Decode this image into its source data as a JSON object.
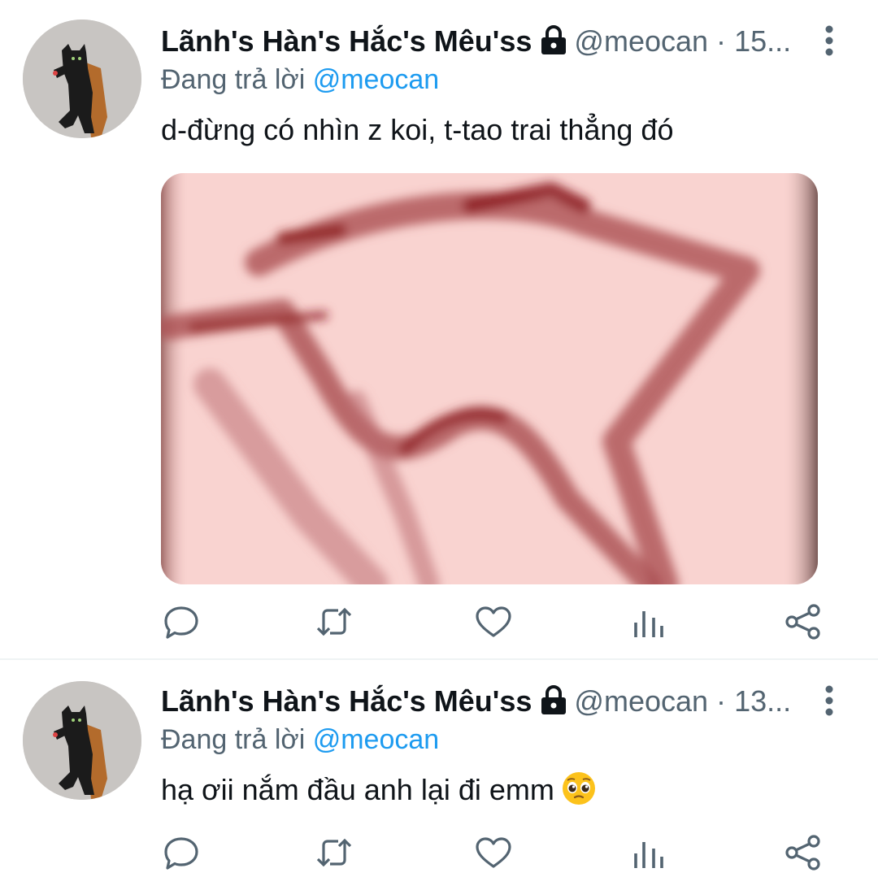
{
  "tweets": [
    {
      "author_name": "Lãnh's Hàn's Hắc's Mêu'ss",
      "handle": "@meocan",
      "separator": "·",
      "time": "15...",
      "reply_prefix": "Đang trả lời",
      "reply_to": "@meocan",
      "text": "d-đừng có nhìn z koi, t-tao trai thẳng đó",
      "has_media": true,
      "emoji": ""
    },
    {
      "author_name": "Lãnh's Hàn's Hắc's Mêu'ss",
      "handle": "@meocan",
      "separator": "·",
      "time": "13...",
      "reply_prefix": "Đang trả lời",
      "reply_to": "@meocan",
      "text": "hạ ơii nắm đầu anh lại đi emm",
      "has_media": false,
      "emoji": "pleading-face-emoji"
    }
  ],
  "icons": {
    "protected": "lock-icon",
    "more": "more-vertical-icon",
    "actions": [
      "reply-icon",
      "retweet-icon",
      "like-icon",
      "views-icon",
      "share-icon"
    ]
  },
  "colors": {
    "text": "#0f1419",
    "secondary": "#536471",
    "link": "#1d9bf0",
    "divider": "#eff3f4",
    "media_bg": "#f8d1ce",
    "media_stroke": "#8e1f22"
  }
}
